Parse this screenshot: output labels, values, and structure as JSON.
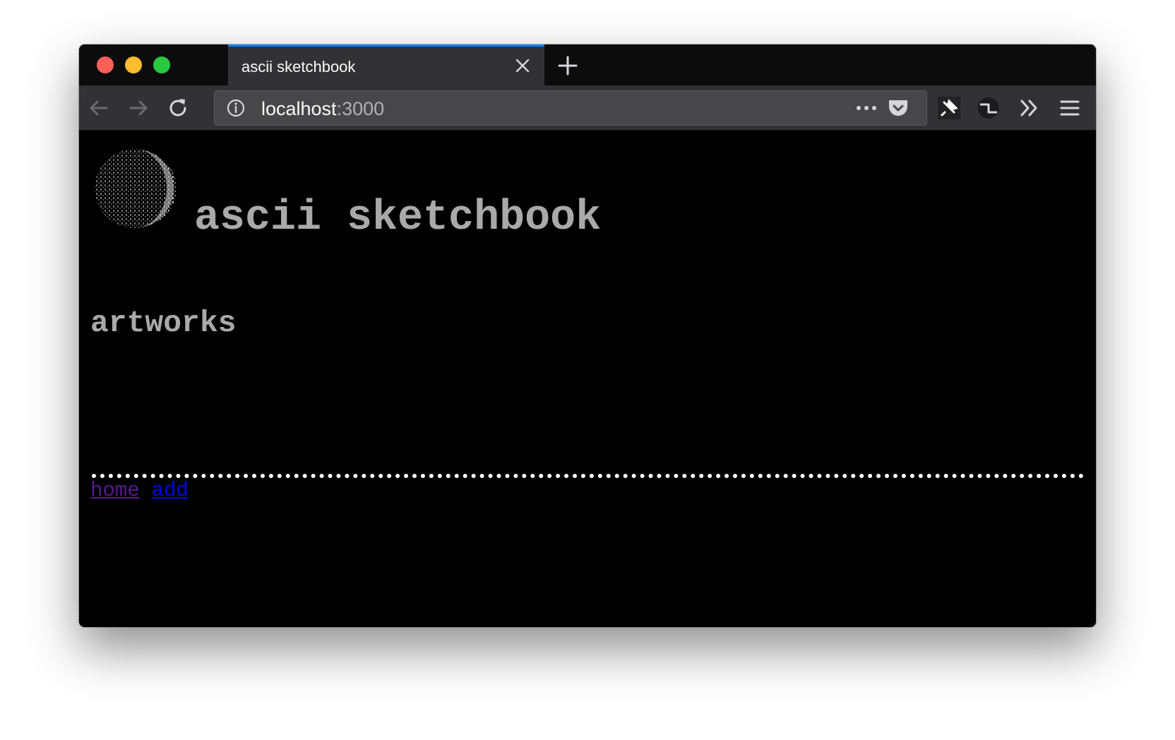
{
  "browser": {
    "tab_title": "ascii sketchbook",
    "url_host": "localhost",
    "url_port": ":3000",
    "accent_color": "#0a84ff"
  },
  "icons": [
    "close-icon",
    "plus-icon",
    "back-arrow-icon",
    "forward-arrow-icon",
    "reload-icon",
    "info-icon",
    "more-actions-icon",
    "pocket-icon",
    "pin-extension-icon",
    "extension-icon",
    "overflow-chevron-icon",
    "hamburger-menu-icon"
  ],
  "page": {
    "site_title": "ascii sketchbook",
    "section_heading": "artworks",
    "nav": {
      "home_label": "home",
      "add_label": "add"
    },
    "colors": {
      "background": "#000000",
      "heading": "#a9a9a9",
      "link_visited": "#551a8b",
      "link": "#0000ee"
    }
  }
}
